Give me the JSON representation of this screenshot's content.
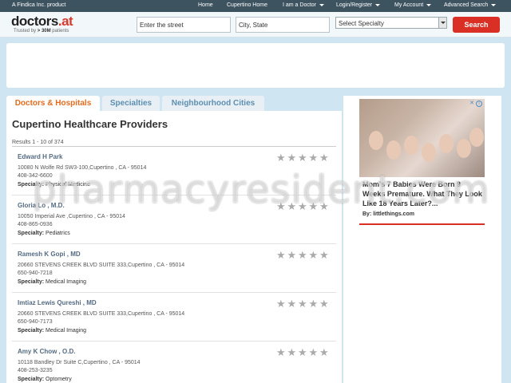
{
  "topbar": {
    "brand": "A Findica Inc. product",
    "nav": [
      {
        "label": "Home",
        "dropdown": false
      },
      {
        "label": "Cupertino Home",
        "dropdown": false
      },
      {
        "label": "I am a Doctor",
        "dropdown": true
      },
      {
        "label": "Login/Register",
        "dropdown": true
      },
      {
        "label": "My Account",
        "dropdown": true
      },
      {
        "label": "Advanced Search",
        "dropdown": true
      }
    ]
  },
  "header": {
    "logo": "doctors",
    "logo_tld": ".at",
    "tagline_prefix": "Trusted by ",
    "tagline_count": "> 30M",
    "tagline_suffix": " patients"
  },
  "search": {
    "street_value": "Enter the street",
    "city_value": "City, State",
    "specialty_value": "Select Specialty",
    "button_label": "Search"
  },
  "tabs": [
    {
      "label": "Doctors & Hospitals",
      "active": true
    },
    {
      "label": "Specialties",
      "active": false
    },
    {
      "label": "Neighbourhood Cities",
      "active": false
    }
  ],
  "main": {
    "title": "Cupertino Healthcare Providers",
    "results_count": "Results 1 - 10 of 374"
  },
  "specialty_label": "Specialty:",
  "providers": [
    {
      "name": "Edward H Park",
      "address": "10080 N Wolfe Rd SW3-100,Cupertino , CA - 95014",
      "phone": "408-342-6600",
      "specialty": "Physical Medicine",
      "rating": 0
    },
    {
      "name": "Gloria Lo , M.D.",
      "address": "10050 Imperial Ave ,Cupertino , CA - 95014",
      "phone": "408-865-0936",
      "specialty": "Pediatrics",
      "rating": 0
    },
    {
      "name": "Ramesh K Gopi , MD",
      "address": "20660 STEVENS CREEK BLVD SUITE 333,Cupertino , CA - 95014",
      "phone": "650-940-7218",
      "specialty": "Medical Imaging",
      "rating": 0
    },
    {
      "name": "Imtiaz Lewis Qureshi , MD",
      "address": "20660 STEVENS CREEK BLVD SUITE 333,Cupertino , CA - 95014",
      "phone": "650-940-7173",
      "specialty": "Medical Imaging",
      "rating": 0
    },
    {
      "name": "Amy K Chow , O.D.",
      "address": "10118 Bandley Dr Suite C,Cupertino , CA - 95014",
      "phone": "408-253-3235",
      "specialty": "Optometry",
      "rating": 0
    }
  ],
  "ad": {
    "headline": "Mom's 7 Babies Were Born 9 Weeks Premature. What They Look Like 18 Years Later?...",
    "source": "By: littlethings.com",
    "close_glyph": "✕",
    "info_glyph": "i"
  },
  "watermark": "pharmacyresident.com",
  "colors": {
    "accent": "#d92f24",
    "tab_active_text": "#e36b1d",
    "tab_inactive_text": "#5d8fb0",
    "name_link": "#556b82",
    "topbar_bg": "#3d5360",
    "page_bg": "#cfe6f2"
  }
}
